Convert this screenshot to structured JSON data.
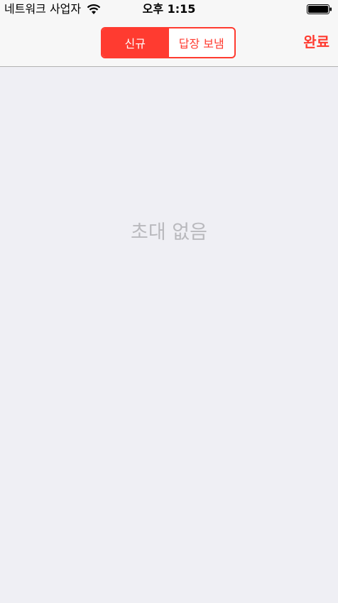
{
  "status_bar": {
    "carrier": "네트워크 사업자",
    "time": "오후 1:15"
  },
  "nav": {
    "segments": [
      {
        "label": "신규",
        "selected": true
      },
      {
        "label": "답장 보냄",
        "selected": false
      }
    ],
    "done_label": "완료"
  },
  "content": {
    "empty_message": "초대 없음"
  },
  "colors": {
    "accent": "#ff3b30",
    "background": "#efeff4",
    "empty_text": "#b9b9bd"
  }
}
